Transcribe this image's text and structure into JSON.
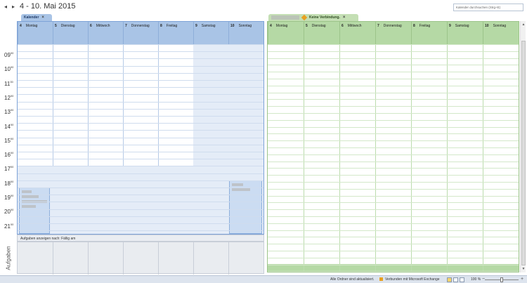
{
  "header": {
    "prev_arrow": "◂",
    "next_arrow": "▸",
    "date_range": "4 - 10. Mai 2015",
    "search_placeholder": "Kalender durchsuchen (Strg+E)"
  },
  "tabs": {
    "left_label": "Kalender",
    "right_label": "Keine Verbindung.",
    "close_glyph": "×"
  },
  "days": [
    {
      "num": "4",
      "name": "Montag"
    },
    {
      "num": "5",
      "name": "Dienstag"
    },
    {
      "num": "6",
      "name": "Mittwoch"
    },
    {
      "num": "7",
      "name": "Donnerstag"
    },
    {
      "num": "8",
      "name": "Freitag"
    },
    {
      "num": "9",
      "name": "Samstag"
    },
    {
      "num": "10",
      "name": "Sonntag"
    }
  ],
  "hours": [
    "09",
    "10",
    "11",
    "12",
    "13",
    "14",
    "15",
    "16",
    "17",
    "18",
    "19",
    "20",
    "21"
  ],
  "hour_suffix": "00",
  "tasks": {
    "header": "Aufgaben anzeigen nach: Fällig am",
    "side_label": "Aufgaben"
  },
  "statusbar": {
    "folders_status": "Alle Ordner sind aktualisiert.",
    "connection_status": "Verbunden mit Microsoft Exchange",
    "zoom": "100 %"
  },
  "colors": {
    "left_calendar": "#a9c4e6",
    "right_calendar": "#b5d9a5",
    "warning": "#e8a020"
  }
}
